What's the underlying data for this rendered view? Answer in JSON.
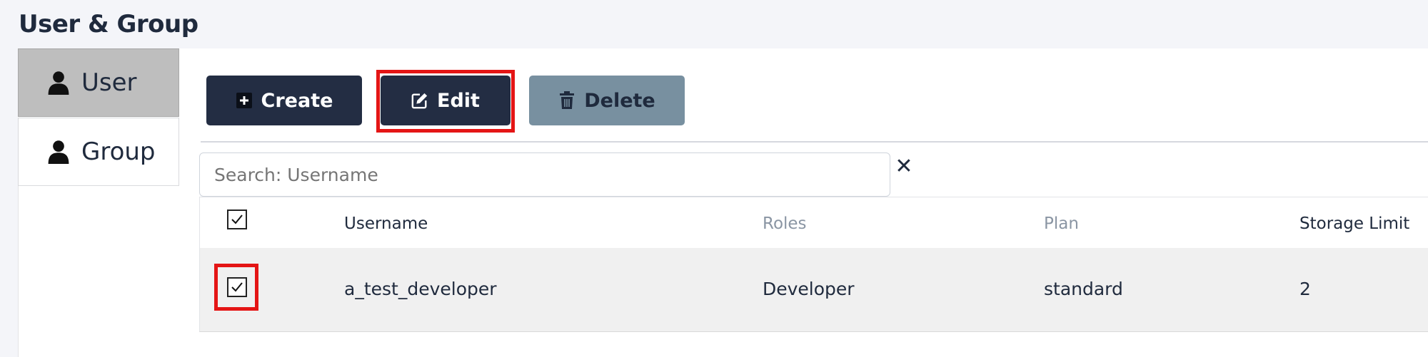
{
  "page": {
    "title": "User & Group"
  },
  "sidebar": {
    "items": [
      {
        "label": "User",
        "icon": "user-icon",
        "active": true
      },
      {
        "label": "Group",
        "icon": "user-icon",
        "active": false
      }
    ]
  },
  "toolbar": {
    "create_label": "Create",
    "edit_label": "Edit",
    "delete_label": "Delete",
    "create_icon": "plus-square-icon",
    "edit_icon": "edit-icon",
    "delete_icon": "trash-icon"
  },
  "search": {
    "placeholder": "Search: Username",
    "clear_icon": "close-icon"
  },
  "table": {
    "header_checked": true,
    "columns": [
      "Username",
      "Roles",
      "Plan",
      "Storage Limit"
    ],
    "rows": [
      {
        "checked": true,
        "username": "a_test_developer",
        "roles": "Developer",
        "plan": "standard",
        "storage_limit": "2"
      }
    ]
  },
  "colors": {
    "primary_button": "#232d43",
    "disabled_button": "#7890a0",
    "highlight": "#e41515",
    "active_tab": "#bebebe"
  }
}
